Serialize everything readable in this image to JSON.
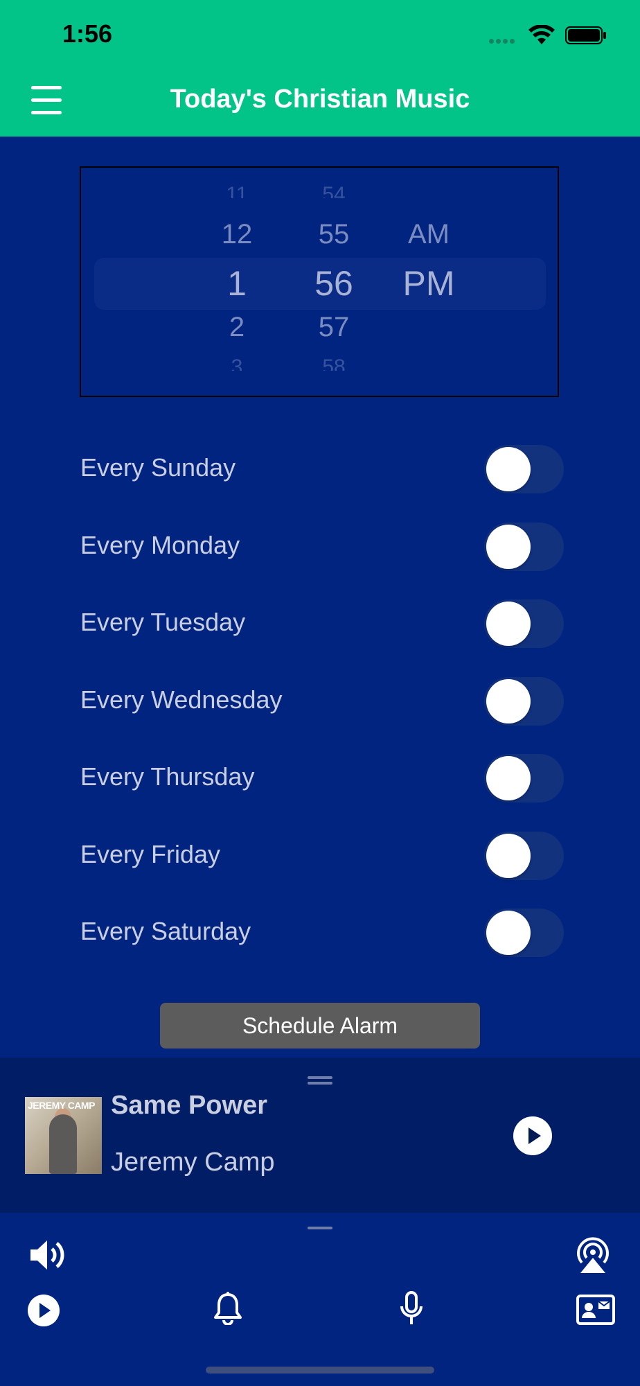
{
  "status_bar": {
    "time": "1:56"
  },
  "header": {
    "title": "Today's Christian Music"
  },
  "picker": {
    "hours": [
      "11",
      "12",
      "1",
      "2",
      "3"
    ],
    "minutes": [
      "54",
      "55",
      "56",
      "57",
      "58"
    ],
    "ampm": [
      "AM",
      "PM"
    ],
    "selected": {
      "hour": "1",
      "minute": "56",
      "period": "PM"
    }
  },
  "days": [
    {
      "label": "Every Sunday",
      "on": false
    },
    {
      "label": "Every Monday",
      "on": false
    },
    {
      "label": "Every Tuesday",
      "on": false
    },
    {
      "label": "Every Wednesday",
      "on": false
    },
    {
      "label": "Every Thursday",
      "on": false
    },
    {
      "label": "Every Friday",
      "on": false
    },
    {
      "label": "Every Saturday",
      "on": false
    }
  ],
  "schedule_button": "Schedule Alarm",
  "now_playing": {
    "title": "Same Power",
    "artist": "Jeremy Camp",
    "album_art_text": "JEREMY CAMP"
  },
  "toolbar": {
    "icons": [
      "volume-icon",
      "airplay-icon",
      "play-icon",
      "bell-icon",
      "microphone-icon",
      "contact-card-icon"
    ]
  },
  "colors": {
    "header": "#03C488",
    "background": "#002480",
    "now_playing_bg": "#011D66",
    "button_bg": "#5C5C5C"
  }
}
